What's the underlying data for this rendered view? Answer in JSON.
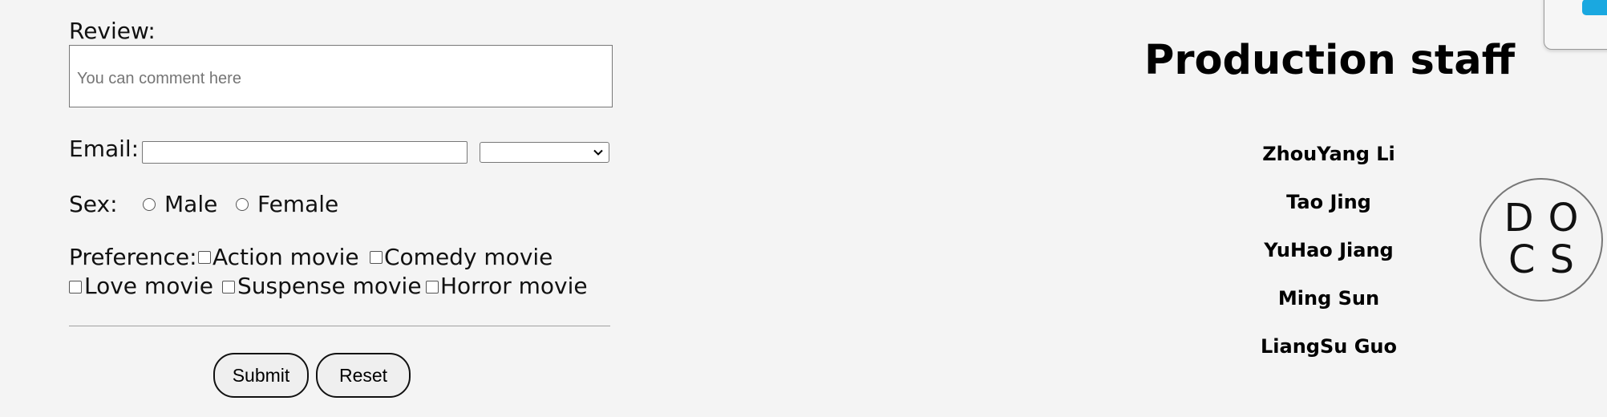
{
  "form": {
    "review_label": "Review:",
    "review_placeholder": "You can comment here",
    "email_label": "Email:",
    "email_value": "",
    "email_domain_selected": "",
    "sex_label": "Sex:",
    "sex_options": [
      "Male",
      "Female"
    ],
    "preference_label": "Preference:",
    "preference_options": [
      "Action movie",
      "Comedy movie",
      "Love movie",
      "Suspense movie",
      "Horror movie"
    ],
    "submit_label": "Submit",
    "reset_label": "Reset"
  },
  "staff": {
    "title": "Production staff",
    "members": [
      "ZhouYang Li",
      "Tao Jing",
      "YuHao Jiang",
      "Ming Sun",
      "LiangSu Guo"
    ]
  },
  "badge": {
    "line1": "DO",
    "line2": "CS"
  },
  "colors": {
    "background": "#f4f4f4",
    "accent": "#1aa8e0"
  }
}
